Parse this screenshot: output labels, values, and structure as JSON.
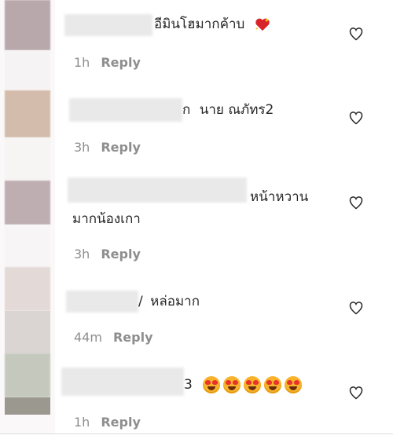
{
  "comments": [
    {
      "text": "อีมินโฮมากค้าบ",
      "time": "1h",
      "reply_label": "Reply",
      "avatar_color": "#b8a8ab"
    },
    {
      "text": "นาย ณภัทร2",
      "text_prefix": "ก",
      "time": "3h",
      "reply_label": "Reply",
      "avatar_color": "#d3bcab"
    },
    {
      "text_line1": "หน้าหวาน",
      "text_line2": "มากน้องเกา",
      "time": "3h",
      "reply_label": "Reply",
      "avatar_color": "#bfaeb1"
    },
    {
      "text": "หล่อมาก",
      "text_prefix": "/",
      "time": "44m",
      "reply_label": "Reply",
      "avatar_color": "#dcd4d2"
    },
    {
      "text_prefix": "3",
      "emoji_name": "heart-eyes-emoji",
      "emoji_count": 5,
      "time": "1h",
      "reply_label": "Reply",
      "avatar_color": "#c5c9bd"
    }
  ],
  "icons": {
    "like": "heart-outline-icon",
    "sparkle_heart": "sparkling-heart-icon"
  },
  "colors": {
    "meta_gray": "#8e8e8e",
    "text": "#262626"
  }
}
